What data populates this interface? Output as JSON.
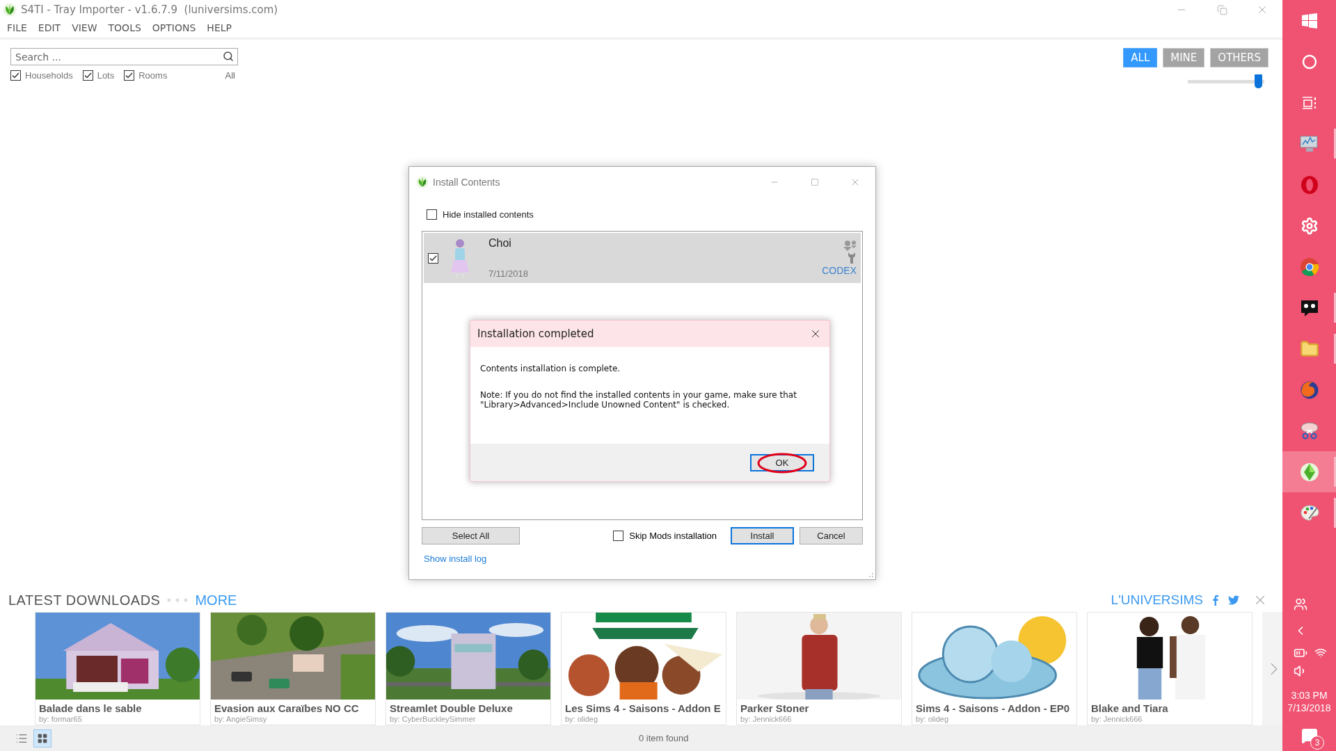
{
  "window": {
    "title": "S4TI - Tray Importer - v1.6.7.9  (luniversims.com)"
  },
  "menu": [
    "FILE",
    "EDIT",
    "VIEW",
    "TOOLS",
    "OPTIONS",
    "HELP"
  ],
  "search": {
    "placeholder": "Search ..."
  },
  "filters": [
    {
      "label": "Households",
      "checked": true
    },
    {
      "label": "Lots",
      "checked": true
    },
    {
      "label": "Rooms",
      "checked": true
    }
  ],
  "filter_all": "All",
  "owner_tabs": [
    {
      "label": "ALL",
      "selected": true
    },
    {
      "label": "MINE",
      "selected": false
    },
    {
      "label": "OTHERS",
      "selected": false
    }
  ],
  "zoom_slider": {
    "level": 0.97
  },
  "install_dialog": {
    "title": "Install Contents",
    "hide_installed": {
      "label": "Hide installed contents",
      "checked": false
    },
    "items": [
      {
        "name": "Choi",
        "date": "7/11/2018",
        "source": "CODEX",
        "checked": true
      }
    ],
    "select_all": "Select All",
    "skip_mods": {
      "label": "Skip Mods installation",
      "checked": false
    },
    "install": "Install",
    "cancel": "Cancel",
    "log_link": "Show install log"
  },
  "message_box": {
    "title": "Installation completed",
    "message": "Contents installation is complete.",
    "note": "Note: If you do not find the installed contents in your game, make sure that \"Library>Advanced>Include Unowned Content\" is checked.",
    "ok": "OK"
  },
  "downloads": {
    "heading": "LATEST DOWNLOADS",
    "more": "MORE",
    "brand": "L'UNIVERSIMS",
    "cards": [
      {
        "title": "Balade dans le sable",
        "author": "by: formar65"
      },
      {
        "title": "Evasion aux Caraïbes NO CC",
        "author": "by: AngieSimsy"
      },
      {
        "title": "Streamlet Double Deluxe",
        "author": "by: CyberBuckleySimmer"
      },
      {
        "title": "Les Sims 4 - Saisons - Addon E",
        "author": "by: olideg"
      },
      {
        "title": "Parker Stoner",
        "author": "by: Jennick666"
      },
      {
        "title": "Sims 4 - Saisons - Addon - EP0",
        "author": "by: olideg"
      },
      {
        "title": "Blake and Tiara",
        "author": "by: Jennick666"
      }
    ]
  },
  "status_bar": {
    "count": "0 item found",
    "view_modes": [
      {
        "kind": "list",
        "selected": false
      },
      {
        "kind": "grid",
        "selected": true
      }
    ]
  },
  "taskbar": {
    "apps": [
      {
        "kind": "start",
        "selected": false,
        "running": false
      },
      {
        "kind": "cortana",
        "selected": false,
        "running": false
      },
      {
        "kind": "taskview",
        "selected": false,
        "running": false
      },
      {
        "kind": "monitor",
        "selected": false,
        "running": true
      },
      {
        "kind": "opera",
        "selected": false,
        "running": false
      },
      {
        "kind": "gear",
        "selected": false,
        "running": false
      },
      {
        "kind": "chrome",
        "selected": false,
        "running": false
      },
      {
        "kind": "imvu",
        "selected": false,
        "running": true
      },
      {
        "kind": "folder",
        "selected": false,
        "running": true
      },
      {
        "kind": "firefox",
        "selected": false,
        "running": false
      },
      {
        "kind": "scissors",
        "selected": false,
        "running": false
      },
      {
        "kind": "sims",
        "selected": true,
        "running": true
      },
      {
        "kind": "paint",
        "selected": false,
        "running": true
      }
    ],
    "clock": {
      "time": "3:03 PM",
      "date": "7/13/2018"
    },
    "notifications": "3"
  }
}
